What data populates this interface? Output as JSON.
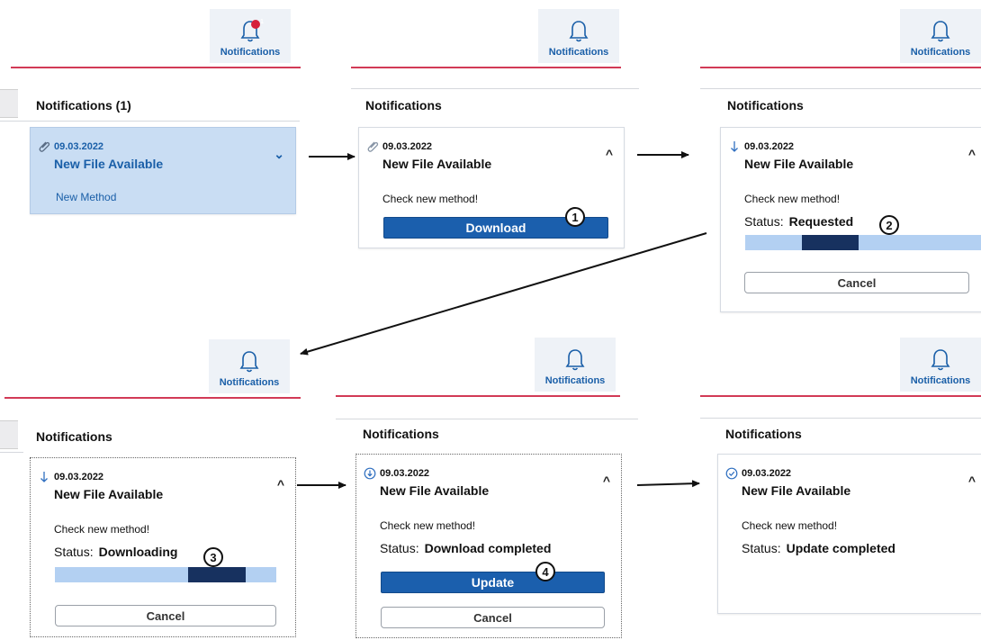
{
  "notifications_label": "Notifications",
  "badge_count": "1",
  "colors": {
    "accent_blue": "#1b5fad",
    "header_red": "#d23a56",
    "selected_bg": "#c9ddf3",
    "progress_light": "#b3d0f2",
    "progress_dark": "#17315f"
  },
  "steps": [
    {
      "panel_title": "Notifications (1)",
      "icon": "paperclip-icon",
      "date": "09.03.2022",
      "title": "New File Available",
      "link": "New Method",
      "caret": "⌄"
    },
    {
      "panel_title": "Notifications",
      "icon": "paperclip-icon",
      "date": "09.03.2022",
      "title": "New File Available",
      "caret": "^",
      "message": "Check new method!",
      "button": "Download",
      "callout": "1"
    },
    {
      "panel_title": "Notifications",
      "icon": "download-arrow-icon",
      "date": "09.03.2022",
      "title": "New File Available",
      "caret": "^",
      "message": "Check new method!",
      "status_label": "Status:",
      "status_value": "Requested",
      "progress": {
        "start": 0.24,
        "end": 0.48
      },
      "cancel": "Cancel",
      "callout": "2"
    },
    {
      "panel_title": "Notifications",
      "icon": "download-arrow-icon",
      "date": "09.03.2022",
      "title": "New File Available",
      "caret": "^",
      "message": "Check new method!",
      "status_label": "Status:",
      "status_value": "Downloading",
      "progress": {
        "start": 0.6,
        "end": 0.86
      },
      "cancel": "Cancel",
      "callout": "3"
    },
    {
      "panel_title": "Notifications",
      "icon": "download-circle-icon",
      "date": "09.03.2022",
      "title": "New File Available",
      "caret": "^",
      "message": "Check new method!",
      "status_label": "Status:",
      "status_value": "Download completed",
      "button": "Update",
      "cancel": "Cancel",
      "callout": "4"
    },
    {
      "panel_title": "Notifications",
      "icon": "check-circle-icon",
      "date": "09.03.2022",
      "title": "New File Available",
      "caret": "^",
      "message": "Check new method!",
      "status_label": "Status:",
      "status_value": "Update completed"
    }
  ]
}
